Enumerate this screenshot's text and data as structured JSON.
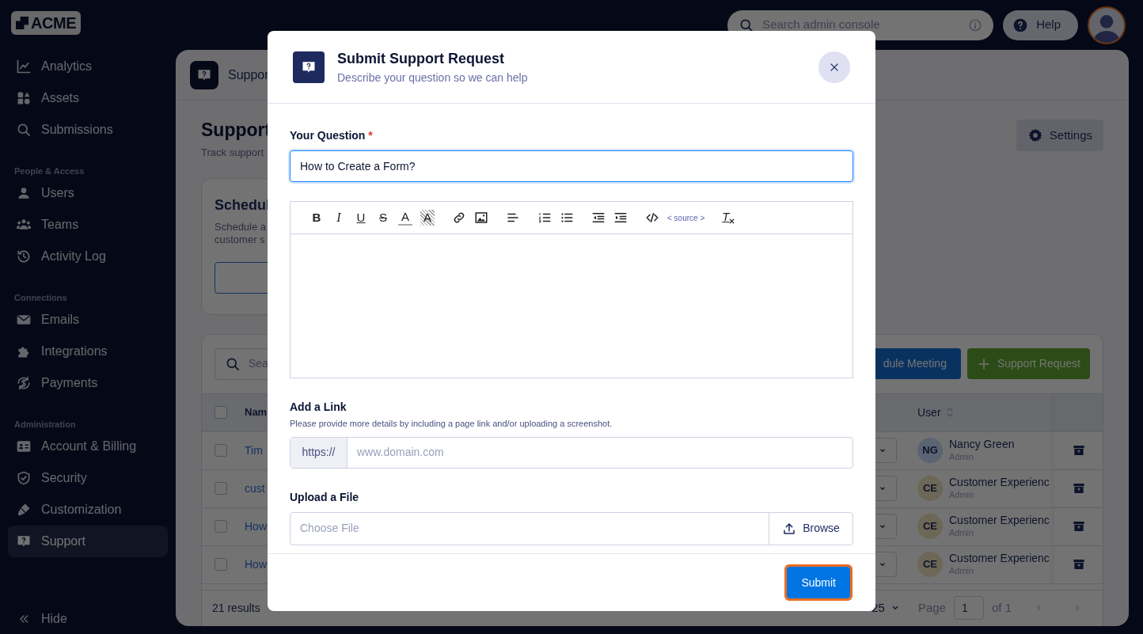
{
  "logo": {
    "text": "ACME"
  },
  "sidebar": {
    "sections": [
      {
        "items": [
          {
            "label": "Analytics",
            "kind": "chart",
            "selected": false
          },
          {
            "label": "Assets",
            "kind": "shapes",
            "selected": false
          },
          {
            "label": "Submissions",
            "kind": "search",
            "selected": false
          }
        ]
      },
      {
        "heading": "People & Access",
        "items": [
          {
            "label": "Users",
            "kind": "user",
            "selected": false
          },
          {
            "label": "Teams",
            "kind": "team",
            "selected": false
          },
          {
            "label": "Activity Log",
            "kind": "history",
            "selected": false
          }
        ]
      },
      {
        "heading": "Connections",
        "items": [
          {
            "label": "Emails",
            "kind": "mail",
            "selected": false
          },
          {
            "label": "Integrations",
            "kind": "puzzle",
            "selected": false
          },
          {
            "label": "Payments",
            "kind": "dollar",
            "selected": false
          }
        ]
      },
      {
        "heading": "Administration",
        "items": [
          {
            "label": "Account & Billing",
            "kind": "card",
            "selected": false
          },
          {
            "label": "Security",
            "kind": "shield",
            "selected": false
          },
          {
            "label": "Customization",
            "kind": "brush",
            "selected": false
          },
          {
            "label": "Support",
            "kind": "support",
            "selected": true
          }
        ]
      }
    ],
    "hide": "Hide"
  },
  "topbar": {
    "search": {
      "placeholder": "Search admin console"
    },
    "help": "Help"
  },
  "page": {
    "header_title": "Suppor",
    "title": "Support",
    "subtitle": "Track support",
    "settings": "Settings",
    "schedule_card": {
      "title": "Schedul",
      "lines": [
        "Schedule a",
        "customer s"
      ]
    },
    "table": {
      "search_placeholder": "Sea",
      "buttons": [
        {
          "label": "dule Meeting",
          "kind": "meeting"
        },
        {
          "label": "Support Request",
          "kind": "request"
        }
      ],
      "columns": {
        "name": "Nam",
        "user": "User"
      },
      "header_checked": false,
      "rows": [
        {
          "checked": false,
          "name": "Tim",
          "initials": "NG",
          "color": "#5a6472",
          "user": "Nancy Green",
          "role": "Admin"
        },
        {
          "checked": false,
          "name": "cust",
          "initials": "CE",
          "color": "#6c6756",
          "user": "Customer Experienc",
          "role": "Admin"
        },
        {
          "checked": false,
          "name": "How",
          "initials": "CE",
          "color": "#6c6756",
          "user": "Customer Experienc",
          "role": "Admin"
        },
        {
          "checked": false,
          "name": "How",
          "initials": "CE",
          "color": "#6c6756",
          "user": "Customer Experienc",
          "role": "Admin"
        }
      ],
      "footer": {
        "results": "21 results",
        "page_size": "25",
        "page_label": "Page",
        "page": "1",
        "of": "of 1"
      }
    }
  },
  "modal": {
    "title": "Submit Support Request",
    "subtitle": "Describe your question so we can help",
    "question": {
      "label": "Your Question",
      "required": "*",
      "value": "How to Create a Form?",
      "focused": true
    },
    "toolbar": [
      {
        "kind": "bold",
        "text": "B"
      },
      {
        "kind": "italic",
        "text": "I"
      },
      {
        "kind": "underline",
        "text": "U"
      },
      {
        "kind": "strike",
        "text": "S"
      },
      {
        "kind": "color",
        "text": "A"
      },
      {
        "kind": "highlight",
        "text": "A"
      },
      {
        "kind": "link"
      },
      {
        "kind": "image"
      },
      {
        "kind": "align"
      },
      {
        "kind": "ordered"
      },
      {
        "kind": "bullets"
      },
      {
        "kind": "outdent"
      },
      {
        "kind": "indent"
      },
      {
        "kind": "code"
      },
      {
        "kind": "source",
        "text": "< source >"
      },
      {
        "kind": "clear",
        "text": "T"
      }
    ],
    "link": {
      "label": "Add a Link",
      "hint": "Please provide more details by including a page link and/or uploading a screenshot.",
      "prefix": "https://",
      "placeholder": "www.domain.com"
    },
    "upload": {
      "label": "Upload a File",
      "placeholder": "Choose File",
      "browse": "Browse"
    },
    "submit": {
      "label": "Submit",
      "focused": true
    }
  }
}
